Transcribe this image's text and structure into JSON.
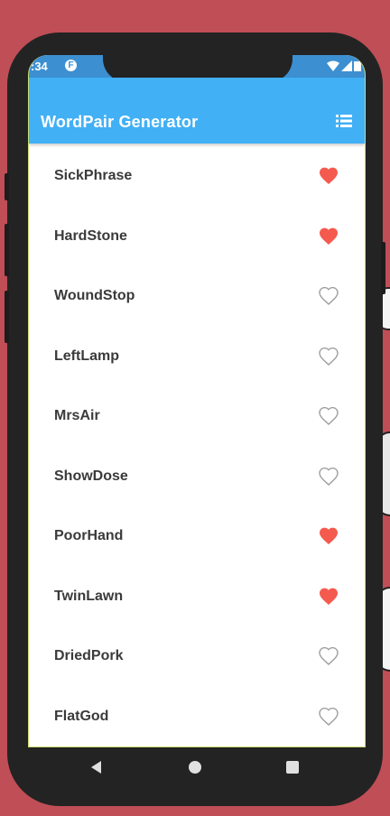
{
  "status_bar": {
    "time": ":34",
    "app_icon_glyph": "F"
  },
  "app_bar": {
    "title": "WordPair Generator",
    "list_icon": "list-icon"
  },
  "colors": {
    "app_bar": "#42b0f5",
    "status_bar": "#3c8fd1",
    "favorite": "#f55a4e",
    "unfavorite_outline": "#9e9e9e",
    "background": "#c04e56"
  },
  "word_pairs": [
    {
      "text": "SickPhrase",
      "saved": true
    },
    {
      "text": "HardStone",
      "saved": true
    },
    {
      "text": "WoundStop",
      "saved": false
    },
    {
      "text": "LeftLamp",
      "saved": false
    },
    {
      "text": "MrsAir",
      "saved": false
    },
    {
      "text": "ShowDose",
      "saved": false
    },
    {
      "text": "PoorHand",
      "saved": true
    },
    {
      "text": "TwinLawn",
      "saved": true
    },
    {
      "text": "DriedPork",
      "saved": false
    },
    {
      "text": "FlatGod",
      "saved": false
    }
  ],
  "nav_bar": {
    "back": "back-icon",
    "home": "home-icon",
    "recents": "recents-icon"
  }
}
